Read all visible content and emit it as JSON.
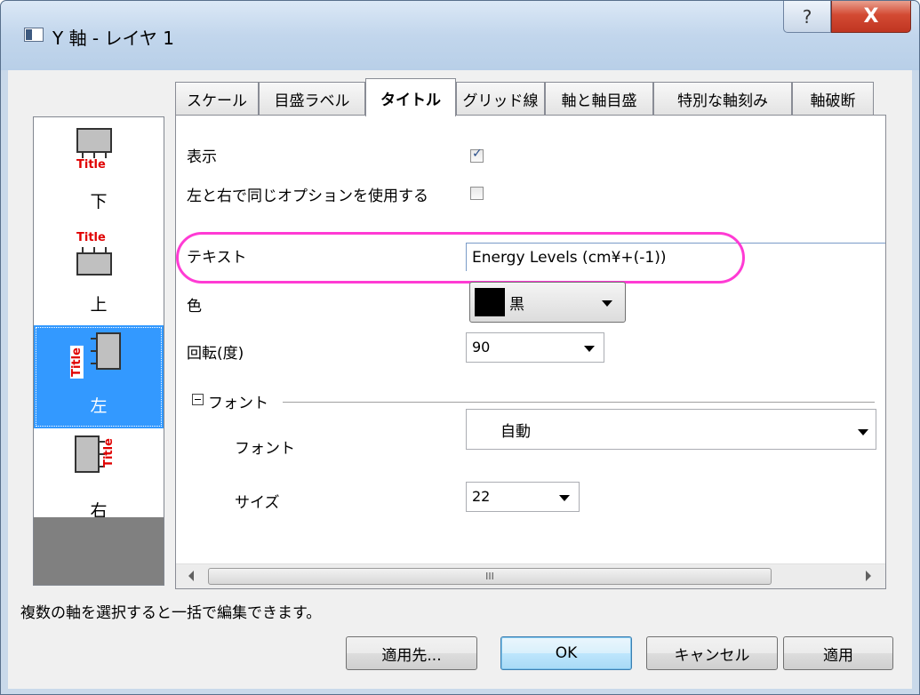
{
  "window": {
    "title": "Y 軸 - レイヤ 1",
    "help_label": "?",
    "close_label": "X"
  },
  "positions": [
    {
      "label": "下",
      "icon": "axis-title-bottom-icon",
      "title_text": "Title"
    },
    {
      "label": "上",
      "icon": "axis-title-top-icon",
      "title_text": "Title"
    },
    {
      "label": "左",
      "icon": "axis-title-left-icon",
      "title_text": "Title",
      "selected": true
    },
    {
      "label": "右",
      "icon": "axis-title-right-icon",
      "title_text": "Title"
    }
  ],
  "tabs": [
    {
      "label": "スケール"
    },
    {
      "label": "目盛ラベル"
    },
    {
      "label": "タイトル",
      "active": true
    },
    {
      "label": "グリッド線"
    },
    {
      "label": "軸と軸目盛"
    },
    {
      "label": "特別な軸刻み"
    },
    {
      "label": "軸破断"
    }
  ],
  "form": {
    "show_label": "表示",
    "show_checked": true,
    "same_options_label": "左と右で同じオプションを使用する",
    "same_options_checked": false,
    "text_label": "テキスト",
    "text_value": "Energy Levels (cm¥+(-1))",
    "color_label": "色",
    "color_value": "黒",
    "color_hex": "#000000",
    "rotation_label": "回転(度)",
    "rotation_value": "90",
    "font_section_label": "フォント",
    "font_label": "フォント",
    "font_value": "自動",
    "size_label": "サイズ",
    "size_value": "22"
  },
  "scrollbar": {
    "thumb_grip": "III"
  },
  "status_text": "複数の軸を選択すると一括で編集できます。",
  "buttons": {
    "apply_to": "適用先...",
    "ok": "OK",
    "cancel": "キャンセル",
    "apply": "適用"
  },
  "colors": {
    "selection": "#3399ff",
    "highlight_ring": "#ff3bd4",
    "title_red": "#e00000",
    "close_red": "#c03521"
  }
}
